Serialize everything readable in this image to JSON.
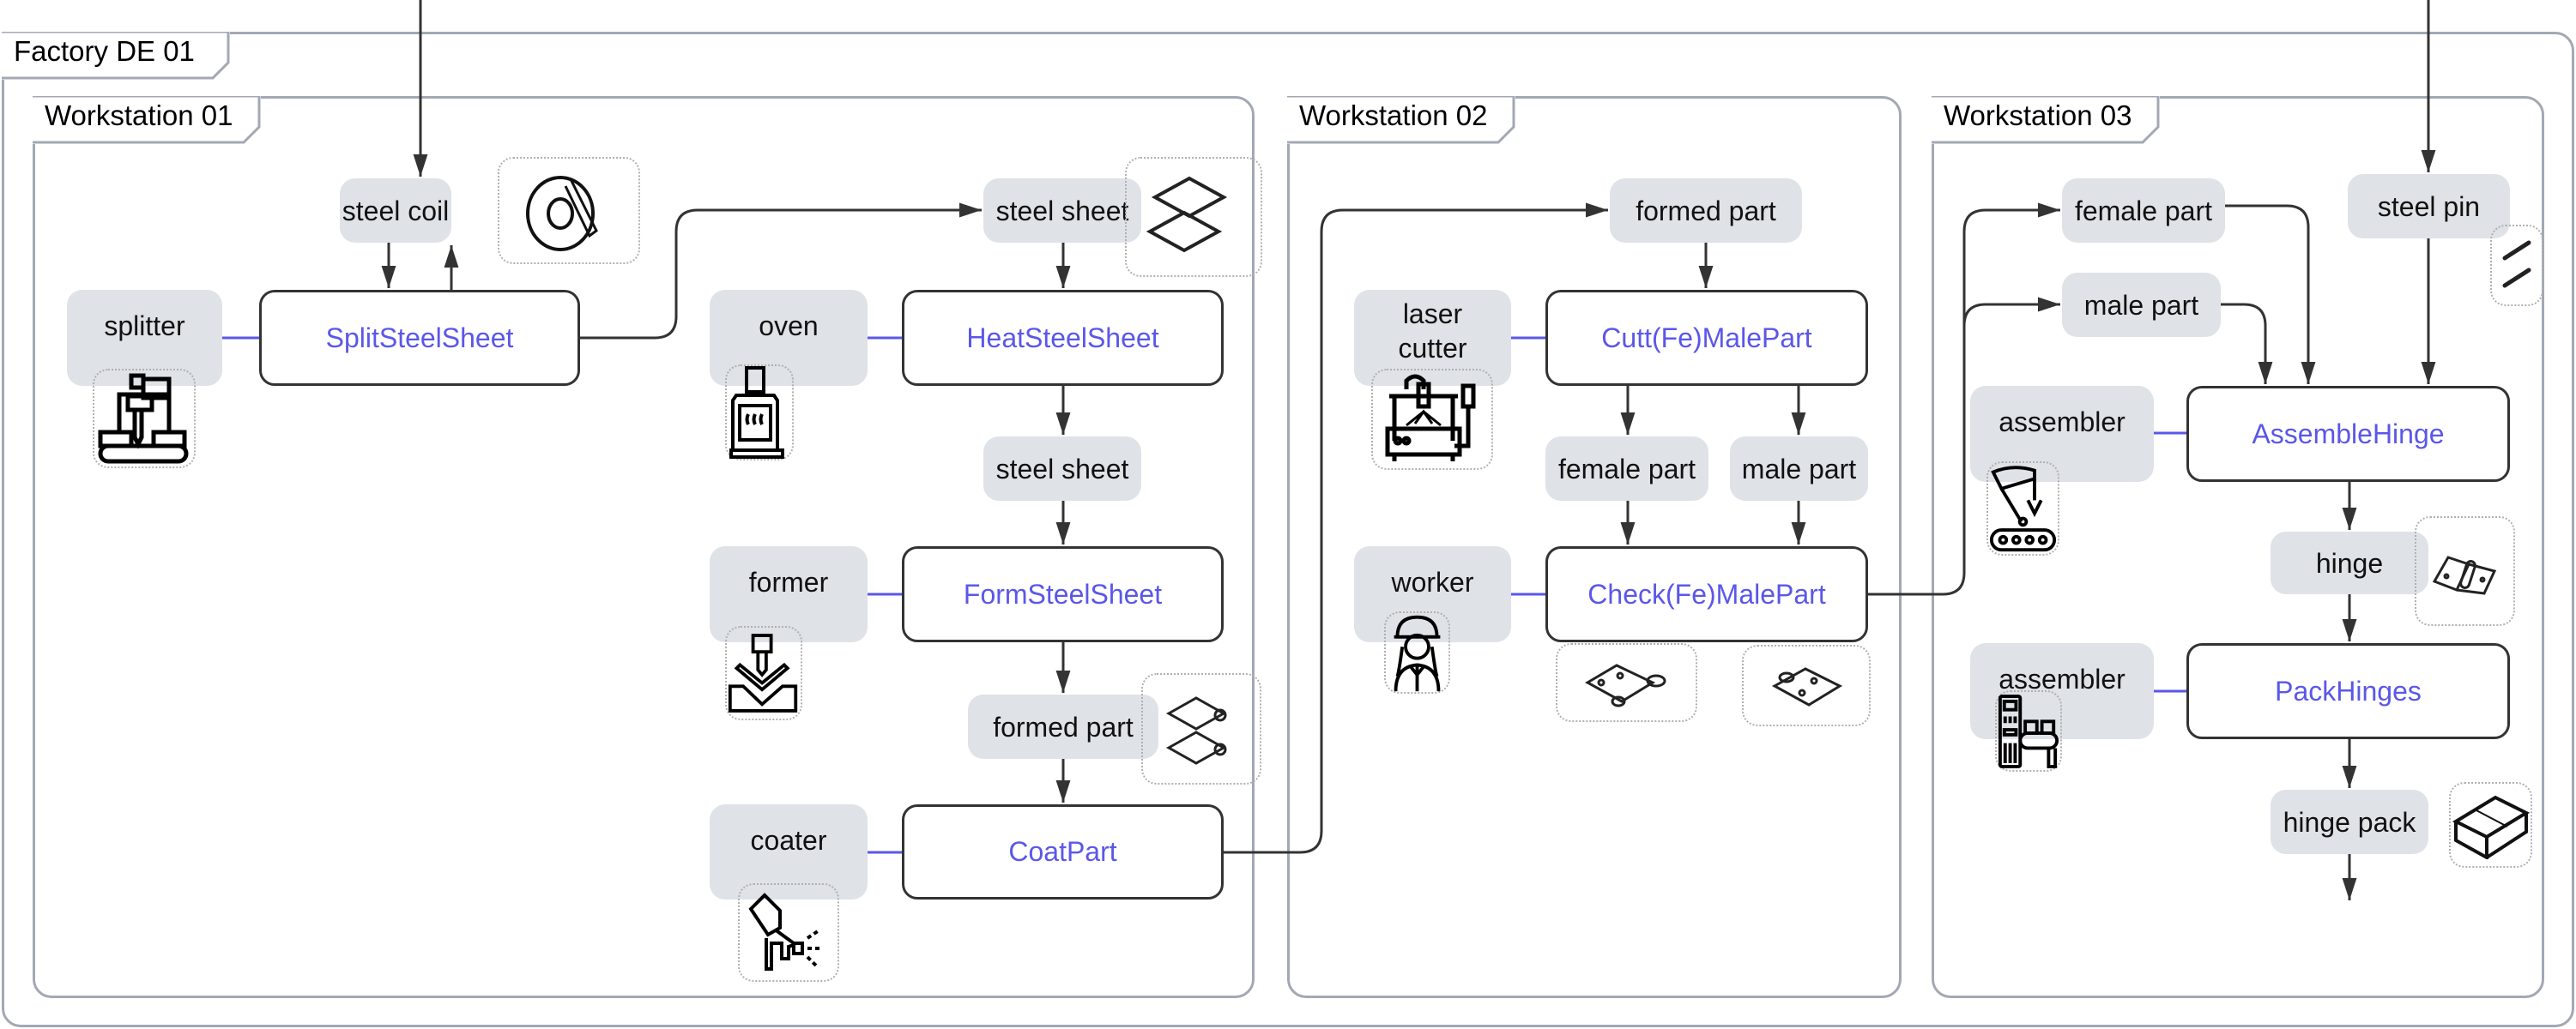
{
  "factory": {
    "title": "Factory DE 01"
  },
  "workstations": [
    {
      "title": "Workstation 01"
    },
    {
      "title": "Workstation 02"
    },
    {
      "title": "Workstation 03"
    }
  ],
  "colors": {
    "activity_text": "#5b57e8",
    "object_fill": "#dfe2e7",
    "frame_border": "#a3a8b4",
    "resource_link": "#5b57e8",
    "arrow": "#333333"
  },
  "objects": {
    "ws1_steel_coil": "steel coil",
    "ws1_steel_sheet_in": "steel sheet",
    "ws1_steel_sheet_mid": "steel sheet",
    "ws1_formed_part": "formed part",
    "ws2_formed_part": "formed part",
    "ws2_female_part": "female part",
    "ws2_male_part": "male part",
    "ws3_female_part": "female part",
    "ws3_male_part": "male part",
    "ws3_steel_pin": "steel pin",
    "ws3_hinge": "hinge",
    "ws3_hinge_pack": "hinge pack"
  },
  "activities": {
    "split": "SplitSteelSheet",
    "heat": "HeatSteelSheet",
    "form": "FormSteelSheet",
    "coat": "CoatPart",
    "cut": "Cutt(Fe)MalePart",
    "check": "Check(Fe)MalePart",
    "assemble": "AssembleHinge",
    "pack": "PackHinges"
  },
  "resources": {
    "splitter": "splitter",
    "oven": "oven",
    "former": "former",
    "coater": "coater",
    "laser_cutter": "laser cutter",
    "worker": "worker",
    "assembler_1": "assembler",
    "assembler_2": "assembler"
  },
  "icons": {
    "steel_coil": "steel-coil-icon",
    "steel_sheet": "steel-sheet-icon",
    "formed_part": "formed-part-icon",
    "female_part": "female-part-icon",
    "male_part": "male-part-icon",
    "steel_pin": "steel-pin-icon",
    "hinge": "hinge-icon",
    "hinge_pack": "box-icon",
    "splitter": "splitter-machine-icon",
    "oven": "oven-icon",
    "former": "press-brake-icon",
    "coater": "spray-gun-icon",
    "laser_cutter": "laser-cutter-icon",
    "worker": "worker-icon",
    "assembler_1": "robot-arm-icon",
    "assembler_2": "packing-machine-icon"
  }
}
